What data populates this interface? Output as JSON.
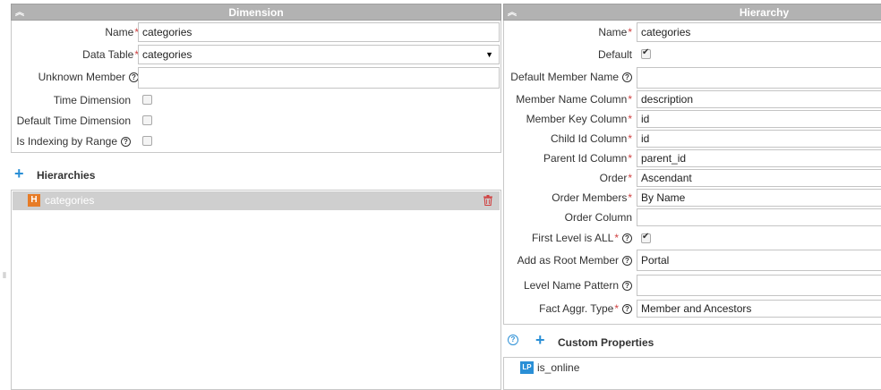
{
  "dimension": {
    "header": "Dimension",
    "fields": {
      "name": {
        "label": "Name",
        "value": "categories"
      },
      "data_table": {
        "label": "Data Table",
        "value": "categories"
      },
      "unknown_member": {
        "label": "Unknown Member",
        "value": ""
      },
      "time_dimension": {
        "label": "Time Dimension",
        "checked": false
      },
      "default_time_dimension": {
        "label": "Default Time Dimension",
        "checked": false
      },
      "is_indexing_by_range": {
        "label": "Is Indexing by Range",
        "checked": false
      }
    },
    "hierarchies": {
      "title": "Hierarchies",
      "items": [
        {
          "badge": "H",
          "label": "categories"
        }
      ]
    }
  },
  "hierarchy": {
    "header": "Hierarchy",
    "fields": {
      "name": {
        "label": "Name",
        "value": "categories"
      },
      "default": {
        "label": "Default",
        "checked": true
      },
      "default_member_name": {
        "label": "Default Member Name",
        "value": ""
      },
      "member_name_column": {
        "label": "Member Name Column",
        "value": "description"
      },
      "member_key_column": {
        "label": "Member Key Column",
        "value": "id"
      },
      "child_id_column": {
        "label": "Child Id Column",
        "value": "id"
      },
      "parent_id_column": {
        "label": "Parent Id Column",
        "value": "parent_id"
      },
      "order": {
        "label": "Order",
        "value": "Ascendant"
      },
      "order_members": {
        "label": "Order Members",
        "value": "By Name"
      },
      "order_column": {
        "label": "Order Column",
        "value": ""
      },
      "first_level_is_all": {
        "label": "First Level is ALL",
        "checked": true
      },
      "add_as_root_member": {
        "label": "Add as Root Member",
        "value": "Portal"
      },
      "level_name_pattern": {
        "label": "Level Name Pattern",
        "value": ""
      },
      "fact_aggr_type": {
        "label": "Fact Aggr. Type",
        "value": "Member and Ancestors"
      }
    },
    "custom_properties": {
      "title": "Custom Properties",
      "items": [
        {
          "badge": "LP",
          "label": "is_online"
        }
      ]
    }
  },
  "colors": {
    "header_bg": "#b2b2b2",
    "required": "#d04040",
    "accent_blue": "#2a8fd6",
    "hierarchy_badge": "#e77c27"
  }
}
